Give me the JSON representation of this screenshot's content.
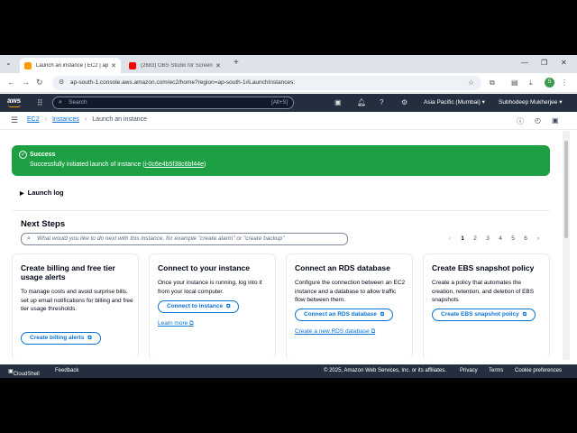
{
  "browser": {
    "tabs": [
      {
        "title": "Launch an instance | EC2 | ap-s",
        "favicon_color": "#ff9900"
      },
      {
        "title": "(2683) OBS Studio for Screen R",
        "favicon_color": "#ff0000"
      }
    ],
    "url": "ap-south-1.console.aws.amazon.com/ec2/home?region=ap-south-1#LaunchInstances:",
    "profile_initial": "S"
  },
  "aws": {
    "logo": "aws",
    "search_placeholder": "Search",
    "search_shortcut": "[Alt+S]",
    "region": "Asia Pacific (Mumbai) ▾",
    "user": "Subhodeep Mukherjee ▾"
  },
  "breadcrumb": [
    "EC2",
    "Instances",
    "Launch an instance"
  ],
  "flash": {
    "title": "Success",
    "message_prefix": "Successfully initiated launch of instance (",
    "instance_id": "i-0c6e4b5f38c6bf44e",
    "message_suffix": ")"
  },
  "launch_log": "Launch log",
  "next_steps": {
    "title": "Next Steps",
    "search_placeholder": "What would you like to do next with this instance, for example \"create alarm\" or \"create backup\"",
    "pages": [
      "1",
      "2",
      "3",
      "4",
      "5",
      "6"
    ],
    "current_page": "1"
  },
  "cards": [
    {
      "title": "Create billing and free tier usage alerts",
      "body": "To manage costs and avoid surprise bills, set up email notifications for billing and free tier usage thresholds.",
      "button": "Create billing alerts",
      "link": ""
    },
    {
      "title": "Connect to your instance",
      "body": "Once your instance is running, log into it from your local computer.",
      "button": "Connect to instance",
      "link": "Learn more"
    },
    {
      "title": "Connect an RDS database",
      "body": "Configure the connection between an EC2 instance and a database to allow traffic flow between them.",
      "button": "Connect an RDS database",
      "link": "Create a new RDS database"
    },
    {
      "title": "Create EBS snapshot policy",
      "body": "Create a policy that automates the creation, retention, and deletion of EBS snapshots",
      "button": "Create EBS snapshot policy",
      "link": ""
    }
  ],
  "footer": {
    "cloudshell": "CloudShell",
    "feedback": "Feedback",
    "copyright": "© 2025, Amazon Web Services, Inc. or its affiliates.",
    "privacy": "Privacy",
    "terms": "Terms",
    "cookies": "Cookie preferences"
  },
  "colors": {
    "success": "#1ca043",
    "aws_nav": "#232f3e",
    "link": "#0972d3",
    "aws_orange": "#ff9900"
  },
  "icons": [
    "tab-search-icon",
    "back-icon",
    "forward-icon",
    "reload-icon",
    "lock-icon",
    "bookmark-star-icon",
    "extension-icon",
    "download-icon",
    "menu-dots-icon",
    "aws-logo",
    "services-grid-icon",
    "search-icon",
    "cloudshell-icon",
    "bell-icon",
    "help-icon",
    "settings-icon",
    "hamburger-icon",
    "info-icon",
    "success-check-icon",
    "external-link-icon"
  ]
}
